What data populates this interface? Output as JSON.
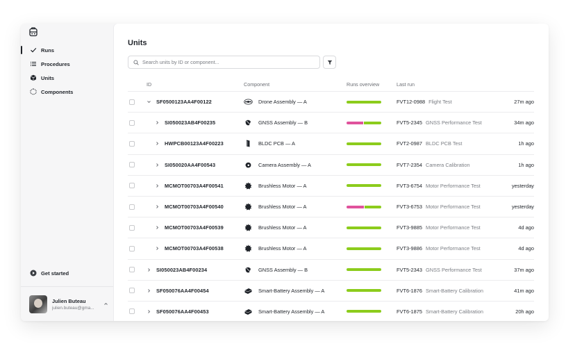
{
  "sidebar": {
    "nav": [
      {
        "label": "Runs",
        "icon": "check-icon",
        "active": true
      },
      {
        "label": "Procedures",
        "icon": "list-icon",
        "active": false
      },
      {
        "label": "Units",
        "icon": "cube-icon",
        "active": false
      },
      {
        "label": "Components",
        "icon": "dashed-cube-icon",
        "active": false
      }
    ],
    "get_started": "Get started",
    "user": {
      "name": "Julien Buteau",
      "email": "julien.buteau@gma..."
    }
  },
  "main": {
    "title": "Units",
    "search_placeholder": "Search units by ID or component...",
    "columns": {
      "id": "ID",
      "component": "Component",
      "runs": "Runs overview",
      "last_run": "Last run"
    },
    "rows": [
      {
        "expand": "down",
        "indent": 0,
        "id": "SF0500123AA4F00122",
        "component": "Drone Assembly — A",
        "icon": "drone-icon",
        "fail_fraction": 0,
        "run_id": "FVT12-0988",
        "run_name": "Flight Test",
        "time": "27m ago"
      },
      {
        "expand": "right",
        "indent": 1,
        "id": "SI050023AB4F00235",
        "component": "GNSS Assembly — B",
        "icon": "satellite-icon",
        "fail_fraction": 0.48,
        "run_id": "FVT5-2345",
        "run_name": "GNSS Performance Test",
        "time": "34m ago"
      },
      {
        "expand": "right",
        "indent": 1,
        "id": "HWPCB00123A4F00223",
        "component": "BLDC PCB — A",
        "icon": "pcb-icon",
        "fail_fraction": 0,
        "run_id": "FVT2-0987",
        "run_name": "BLDC PCB Test",
        "time": "1h ago"
      },
      {
        "expand": "right",
        "indent": 1,
        "id": "SI050020AA4F00543",
        "component": "Camera Assembly — A",
        "icon": "camera-icon",
        "fail_fraction": 0,
        "run_id": "FVT7-2354",
        "run_name": "Camera Calibration",
        "time": "1h ago"
      },
      {
        "expand": "right",
        "indent": 1,
        "id": "MCMOT00703A4F00541",
        "component": "Brushless Motor — A",
        "icon": "motor-icon",
        "fail_fraction": 0,
        "run_id": "FVT3-6754",
        "run_name": "Motor Performance Test",
        "time": "yesterday"
      },
      {
        "expand": "right",
        "indent": 1,
        "id": "MCMOT00703A4F00540",
        "component": "Brushless Motor — A",
        "icon": "motor-icon",
        "fail_fraction": 0.5,
        "run_id": "FVT3-6753",
        "run_name": "Motor Performance Test",
        "time": "yesterday"
      },
      {
        "expand": "right",
        "indent": 1,
        "id": "MCMOT00703A4F00539",
        "component": "Brushless Motor — A",
        "icon": "motor-icon",
        "fail_fraction": 0,
        "run_id": "FVT3-9885",
        "run_name": "Motor Performance Test",
        "time": "4d ago"
      },
      {
        "expand": "right",
        "indent": 1,
        "id": "MCMOT00703A4F00538",
        "component": "Brushless Motor — A",
        "icon": "motor-icon",
        "fail_fraction": 0,
        "run_id": "FVT3-9886",
        "run_name": "Motor Performance Test",
        "time": "4d ago"
      },
      {
        "expand": "right",
        "indent": 0,
        "id": "SI050023AB4F00234",
        "component": "GNSS Assembly — B",
        "icon": "satellite-icon",
        "fail_fraction": 0,
        "run_id": "FVT5-2343",
        "run_name": "GNSS Performance Test",
        "time": "37m ago"
      },
      {
        "expand": "right",
        "indent": 0,
        "id": "SF050076AA4F00454",
        "component": "Smart-Battery Assembly — A",
        "icon": "battery-icon",
        "fail_fraction": 0,
        "run_id": "FVT6-1876",
        "run_name": "Smart-Battery Calibration",
        "time": "41m ago"
      },
      {
        "expand": "right",
        "indent": 0,
        "id": "SF050076AA4F00453",
        "component": "Smart-Battery Assembly — A",
        "icon": "battery-icon",
        "fail_fraction": 0,
        "run_id": "FVT6-1875",
        "run_name": "Smart-Battery Calibration",
        "time": "20h ago"
      }
    ]
  },
  "colors": {
    "pass": "#8ccc1c",
    "fail": "#e0529c",
    "text": "#1f2329",
    "muted": "#7a7d83"
  }
}
